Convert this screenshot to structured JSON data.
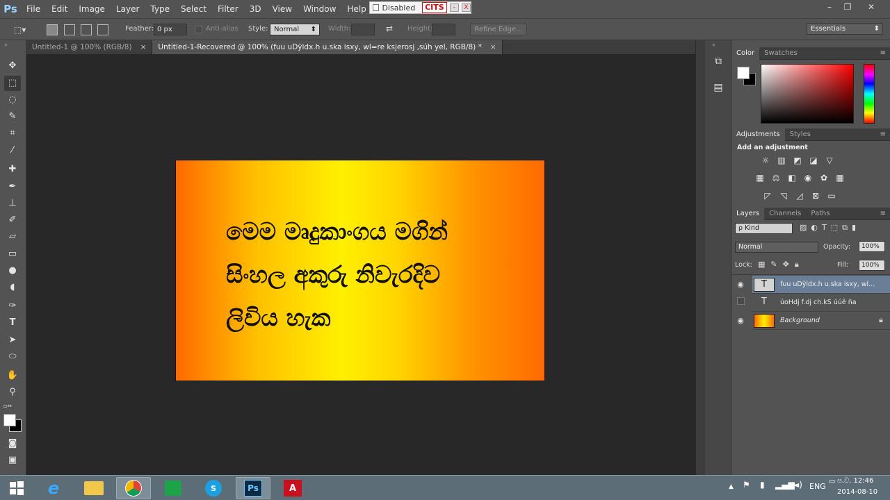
{
  "app": {
    "logo": "Ps",
    "menu": [
      "File",
      "Edit",
      "Image",
      "Layer",
      "Type",
      "Select",
      "Filter",
      "3D",
      "View",
      "Window",
      "Help"
    ],
    "window_controls": {
      "minimize": "–",
      "restore": "❐",
      "close": "✕"
    }
  },
  "cits_widget": {
    "label": "Disabled",
    "brand": "CITS",
    "min": "-",
    "close": "X"
  },
  "options_bar": {
    "feather_label": "Feather:",
    "feather_value": "0 px",
    "antialias_label": "Anti-alias",
    "style_label": "Style:",
    "style_value": "Normal",
    "width_label": "Width:",
    "height_label": "Height:",
    "refine_edge": "Refine Edge...",
    "workspace": "Essentials"
  },
  "tabs": [
    {
      "label": "Untitled-1 @ 100% (RGB/8)",
      "close": "×"
    },
    {
      "label": "Untitled-1-Recovered @ 100% (fuu uDÿldx.h u.ska isxy, wl=re ksjerosj ,súh yel, RGB/8) *",
      "close": "×"
    }
  ],
  "canvas": {
    "text": "මෙම මෘදුකාංගය මගින්\nසිංහල අකුරු නිවැරදිව\nලිවිය හැක",
    "gradient_colors": [
      "#ff6a00",
      "#fff000",
      "#ff6a00"
    ]
  },
  "color_panel": {
    "tabs": [
      "Color",
      "Swatches"
    ],
    "menu": "≡"
  },
  "adjustments_panel": {
    "tabs": [
      "Adjustments",
      "Styles"
    ],
    "title": "Add an adjustment",
    "menu": "≡"
  },
  "layers_panel": {
    "tabs": [
      "Layers",
      "Channels",
      "Paths"
    ],
    "menu": "≡",
    "kind": "ρ Kind",
    "blend_mode": "Normal",
    "opacity_label": "Opacity:",
    "opacity_value": "100%",
    "lock_label": "Lock:",
    "fill_label": "Fill:",
    "fill_value": "100%",
    "layers": [
      {
        "name": "fuu uDÿldx.h u.ska isxy, wl...",
        "type": "T",
        "visible": true,
        "active": true
      },
      {
        "name": "úoHdj f.dj ch.kS úúê ña",
        "type": "T",
        "visible": false,
        "active": false
      },
      {
        "name": "Background",
        "type": "gradient",
        "visible": true,
        "active": false,
        "locked": true
      }
    ]
  },
  "taskbar": {
    "lang": "ENG",
    "time": "ප.ව. 12:46",
    "date": "2014-08-10",
    "apps": [
      "windows-start",
      "internet-explorer",
      "file-explorer",
      "chrome",
      "windows-store",
      "skype",
      "photoshop",
      "acrobat"
    ]
  },
  "colors": {
    "accent": "#6a7f97",
    "panel": "#535353",
    "canvas_bg": "#282828"
  }
}
